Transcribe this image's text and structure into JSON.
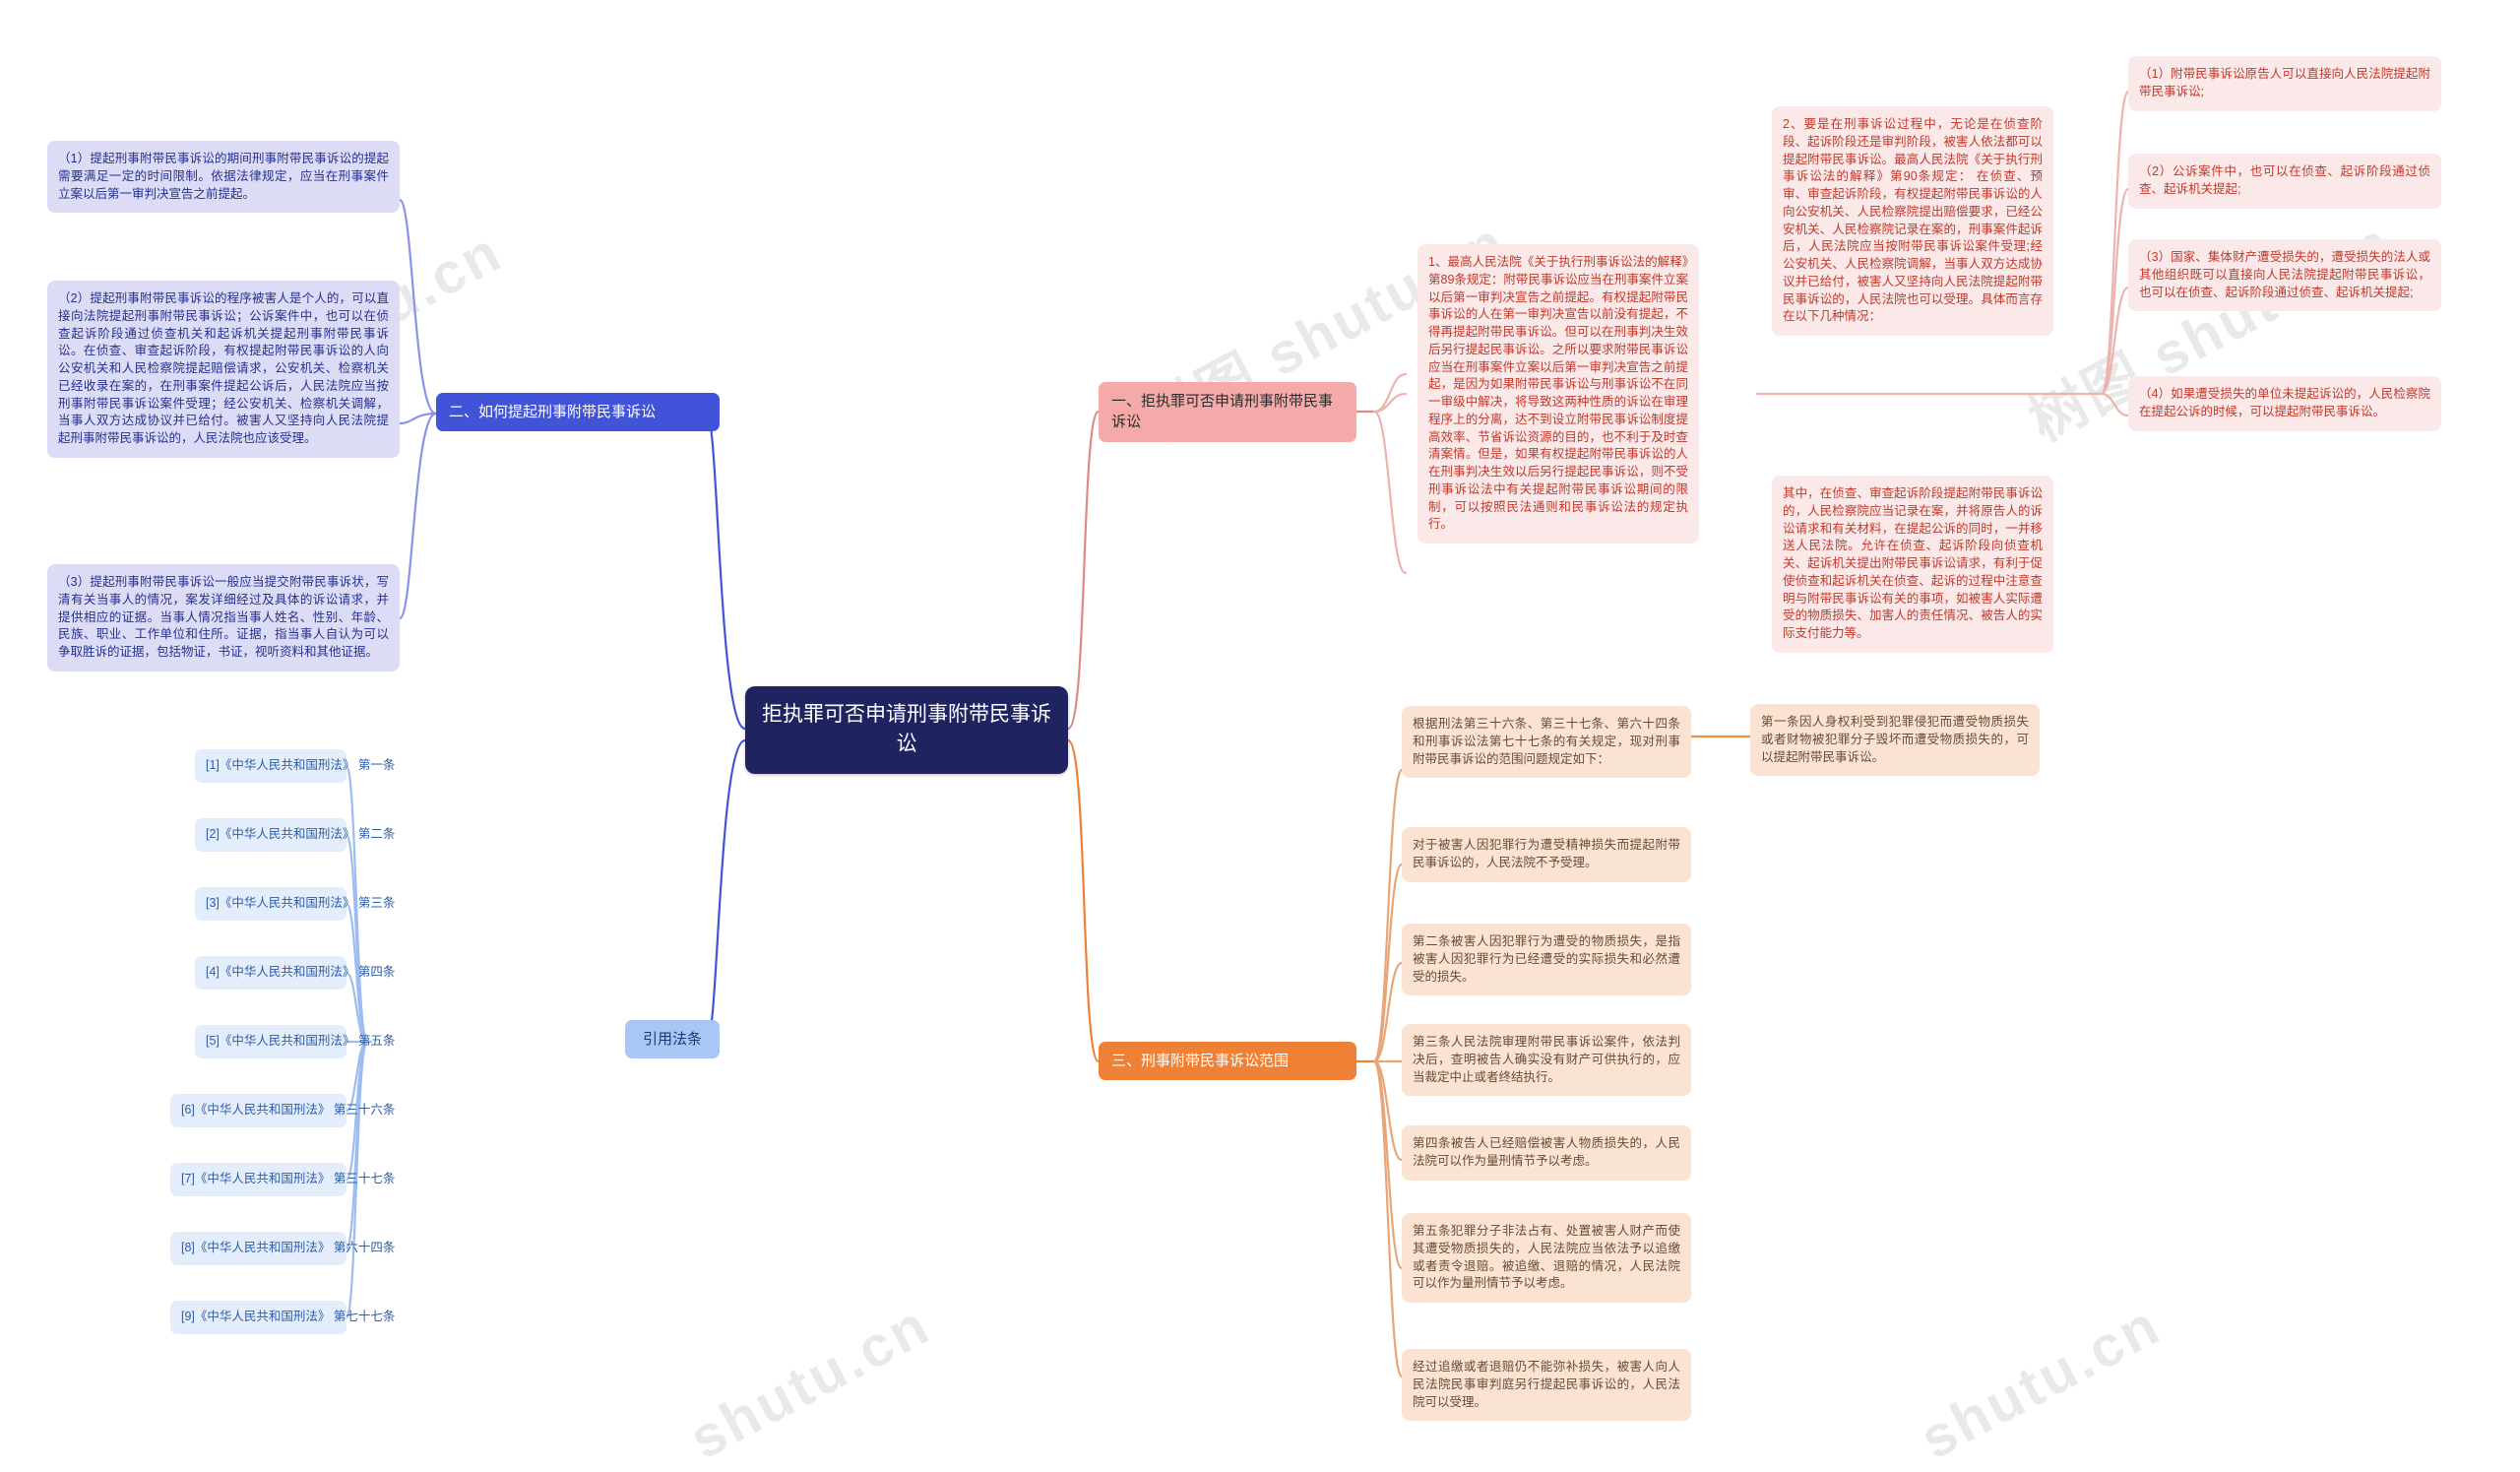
{
  "root": {
    "title": "拒执罪可否申请刑事附带民事诉讼"
  },
  "watermarks": [
    "树图 shutu.cn",
    "树图 shutu.cn",
    "树图 shutu.cn",
    "shutu.cn",
    "shutu.cn"
  ],
  "branches": {
    "how_to_file": {
      "label": "二、如何提起刑事附带民事诉讼",
      "color": "#4153d8",
      "items": [
        "（1）提起刑事附带民事诉讼的期间刑事附带民事诉讼的提起需要满足一定的时间限制。依据法律规定，应当在刑事案件立案以后第一审判决宣告之前提起。",
        "（2）提起刑事附带民事诉讼的程序被害人是个人的，可以直接向法院提起刑事附带民事诉讼；公诉案件中，也可以在侦查起诉阶段通过侦查机关和起诉机关提起刑事附带民事诉讼。在侦查、审查起诉阶段，有权提起附带民事诉讼的人向公安机关和人民检察院提起赔偿请求，公安机关、检察机关已经收录在案的，在刑事案件提起公诉后，人民法院应当按刑事附带民事诉讼案件受理；经公安机关、检察机关调解，当事人双方达成协议并已给付。被害人又坚持向人民法院提起刑事附带民事诉讼的，人民法院也应该受理。",
        "（3）提起刑事附带民事诉讼一般应当提交附带民事诉状，写清有关当事人的情况，案发详细经过及具体的诉讼请求，并提供相应的证据。当事人情况指当事人姓名、性别、年龄、民族、职业、工作单位和住所。证据，指当事人自认为可以争取胜诉的证据，包括物证，书证，视听资料和其他证据。"
      ]
    },
    "cited_laws": {
      "label": "引用法条",
      "color": "#a9c6f5",
      "items": [
        "[1]《中华人民共和国刑法》 第一条",
        "[2]《中华人民共和国刑法》 第二条",
        "[3]《中华人民共和国刑法》 第三条",
        "[4]《中华人民共和国刑法》 第四条",
        "[5]《中华人民共和国刑法》 第五条",
        "[6]《中华人民共和国刑法》 第三十六条",
        "[7]《中华人民共和国刑法》 第三十七条",
        "[8]《中华人民共和国刑法》 第六十四条",
        "[9]《中华人民共和国刑法》 第七十七条"
      ]
    },
    "can_apply": {
      "label": "一、拒执罪可否申请刑事附带民事诉讼",
      "color": "#f4aaa8",
      "items": [
        "1、最高人民法院《关于执行刑事诉讼法的解释》第89条规定：附带民事诉讼应当在刑事案件立案以后第一审判决宣告之前提起。有权提起附带民事诉讼的人在第一审判决宣告以前没有提起，不得再提起附带民事诉讼。但可以在刑事判决生效后另行提起民事诉讼。之所以要求附带民事诉讼应当在刑事案件立案以后第一审判决宣告之前提起，是因为如果附带民事诉讼与刑事诉讼不在同一审级中解决，将导致这两种性质的诉讼在审理程序上的分离，达不到设立附带民事诉讼制度提高效率、节省诉讼资源的目的，也不利于及时查清案情。但是，如果有权提起附带民事诉讼的人在刑事判决生效以后另行提起民事诉讼，则不受刑事诉讼法中有关提起附带民事诉讼期间的限制，可以按照民法通则和民事诉讼法的规定执行。",
        "2、要是在刑事诉讼过程中，无论是在侦查阶段、起诉阶段还是审判阶段，被害人依法都可以提起附带民事诉讼。最高人民法院《关于执行刑事诉讼法的解释》第90条规定： 在侦查、预审、审查起诉阶段，有权提起附带民事诉讼的人向公安机关、人民检察院提出赔偿要求，已经公安机关、人民检察院记录在案的，刑事案件起诉后，人民法院应当按附带民事诉讼案件受理;经公安机关、人民检察院调解，当事人双方达成协议并已给付，被害人又坚持向人民法院提起附带民事诉讼的，人民法院也可以受理。具体而言存在以下几种情况：",
        "其中，在侦查、审查起诉阶段提起附带民事诉讼的，人民检察院应当记录在案，并将原告人的诉讼请求和有关材料，在提起公诉的同时，一并移送人民法院。允许在侦查、起诉阶段向侦查机关、起诉机关提出附带民事诉讼请求，有利于促使侦查和起诉机关在侦查、起诉的过程中注意查明与附带民事诉讼有关的事项，如被害人实际遭受的物质损失、加害人的责任情况、被告人的实际支付能力等。"
      ],
      "sub_items": [
        "（1）附带民事诉讼原告人可以直接向人民法院提起附带民事诉讼;",
        "（2）公诉案件中，也可以在侦查、起诉阶段通过侦查、起诉机关提起;",
        "（3）国家、集体财产遭受损失的，遭受损失的法人或其他组织既可以直接向人民法院提起附带民事诉讼，也可以在侦查、起诉阶段通过侦查、起诉机关提起;",
        "（4）如果遭受损失的单位未提起诉讼的，人民检察院在提起公诉的时候，可以提起附带民事诉讼。"
      ]
    },
    "scope": {
      "label": "三、刑事附带民事诉讼范围",
      "color": "#ef8136",
      "items": [
        "根据刑法第三十六条、第三十七条、第六十四条和刑事诉讼法第七十七条的有关规定，现对刑事附带民事诉讼的范围问题规定如下：",
        "对于被害人因犯罪行为遭受精神损失而提起附带民事诉讼的，人民法院不予受理。",
        "第二条被害人因犯罪行为遭受的物质损失，是指被害人因犯罪行为已经遭受的实际损失和必然遭受的损失。",
        "第三条人民法院审理附带民事诉讼案件，依法判决后，查明被告人确实没有财产可供执行的，应当裁定中止或者终结执行。",
        "第四条被告人已经赔偿被害人物质损失的，人民法院可以作为量刑情节予以考虑。",
        "第五条犯罪分子非法占有、处置被害人财产而使其遭受物质损失的，人民法院应当依法予以追缴或者责令退赔。被追缴、退赔的情况，人民法院可以作为量刑情节予以考虑。",
        "经过追缴或者退赔仍不能弥补损失，被害人向人民法院民事审判庭另行提起民事诉讼的，人民法院可以受理。"
      ],
      "sub_items": [
        "第一条因人身权利受到犯罪侵犯而遭受物质损失或者财物被犯罪分子毁坏而遭受物质损失的，可以提起附带民事诉讼。"
      ]
    }
  }
}
